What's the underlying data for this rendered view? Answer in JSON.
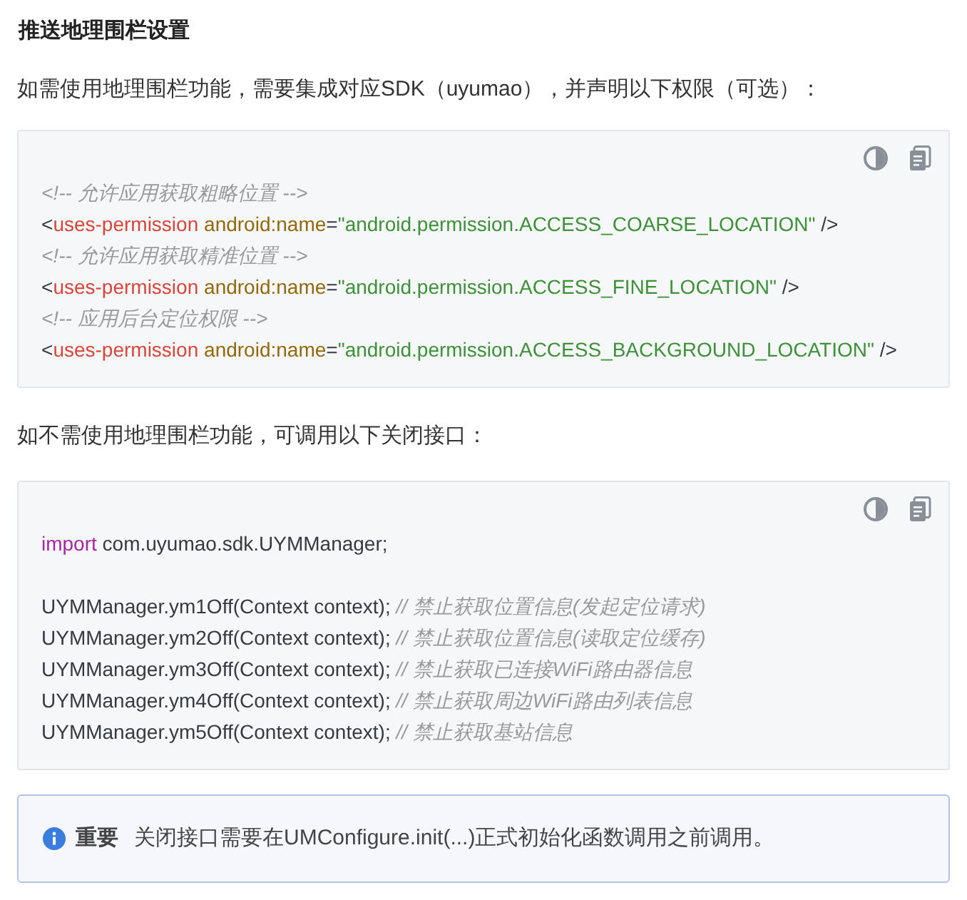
{
  "title": "推送地理围栏设置",
  "intro": "如需使用地理围栏功能，需要集成对应SDK（uyumao），并声明以下权限（可选）：",
  "code_block_1": {
    "lines": [
      [
        {
          "kind": "comment",
          "text": "<!-- 允许应用获取粗略位置 -->"
        }
      ],
      [
        {
          "kind": "plain",
          "text": "<"
        },
        {
          "kind": "tag",
          "text": "uses-permission"
        },
        {
          "kind": "attr",
          "text": "android:name"
        },
        {
          "kind": "plain",
          "text": "="
        },
        {
          "kind": "string",
          "text": "\"android.permission.ACCESS_COARSE_LOCATION\""
        },
        {
          "kind": "plain",
          "text": " />"
        }
      ],
      [
        {
          "kind": "comment",
          "text": "<!-- 允许应用获取精准位置 -->"
        }
      ],
      [
        {
          "kind": "plain",
          "text": "<"
        },
        {
          "kind": "tag",
          "text": "uses-permission"
        },
        {
          "kind": "attr",
          "text": "android:name"
        },
        {
          "kind": "plain",
          "text": "="
        },
        {
          "kind": "string",
          "text": "\"android.permission.ACCESS_FINE_LOCATION\""
        },
        {
          "kind": "plain",
          "text": " />"
        }
      ],
      [
        {
          "kind": "comment",
          "text": "<!-- 应用后台定位权限 -->"
        }
      ],
      [
        {
          "kind": "plain",
          "text": "<"
        },
        {
          "kind": "tag",
          "text": "uses-permission"
        },
        {
          "kind": "attr",
          "text": "android:name"
        },
        {
          "kind": "plain",
          "text": "="
        },
        {
          "kind": "string",
          "text": "\"android.permission.ACCESS_BACKGROUND_LOCATION\""
        },
        {
          "kind": "plain",
          "text": " />"
        }
      ]
    ]
  },
  "close_intro": "如不需使用地理围栏功能，可调用以下关闭接口：",
  "code_block_2": {
    "lines": [
      [
        {
          "kind": "keyword",
          "text": "import"
        },
        {
          "kind": "plain",
          "text": " com.uyumao.sdk.UYMManager;"
        }
      ],
      [
        {
          "kind": "blank_line"
        }
      ],
      [
        {
          "kind": "plain",
          "text": "UYMManager.ym1Off(Context context); "
        },
        {
          "kind": "comment",
          "text": "// 禁止获取位置信息(发起定位请求)"
        }
      ],
      [
        {
          "kind": "plain",
          "text": "UYMManager.ym2Off(Context context); "
        },
        {
          "kind": "comment",
          "text": "// 禁止获取位置信息(读取定位缓存)"
        }
      ],
      [
        {
          "kind": "plain",
          "text": "UYMManager.ym3Off(Context context); "
        },
        {
          "kind": "comment",
          "text": "// 禁止获取已连接WiFi路由器信息"
        }
      ],
      [
        {
          "kind": "plain",
          "text": "UYMManager.ym4Off(Context context); "
        },
        {
          "kind": "comment",
          "text": "// 禁止获取周边WiFi路由列表信息"
        }
      ],
      [
        {
          "kind": "plain",
          "text": "UYMManager.ym5Off(Context context); "
        },
        {
          "kind": "comment",
          "text": "// 禁止获取基站信息"
        }
      ]
    ]
  },
  "notice": {
    "label": "重要",
    "text": "关闭接口需要在UMConfigure.init(...)正式初始化函数调用之前调用。"
  }
}
